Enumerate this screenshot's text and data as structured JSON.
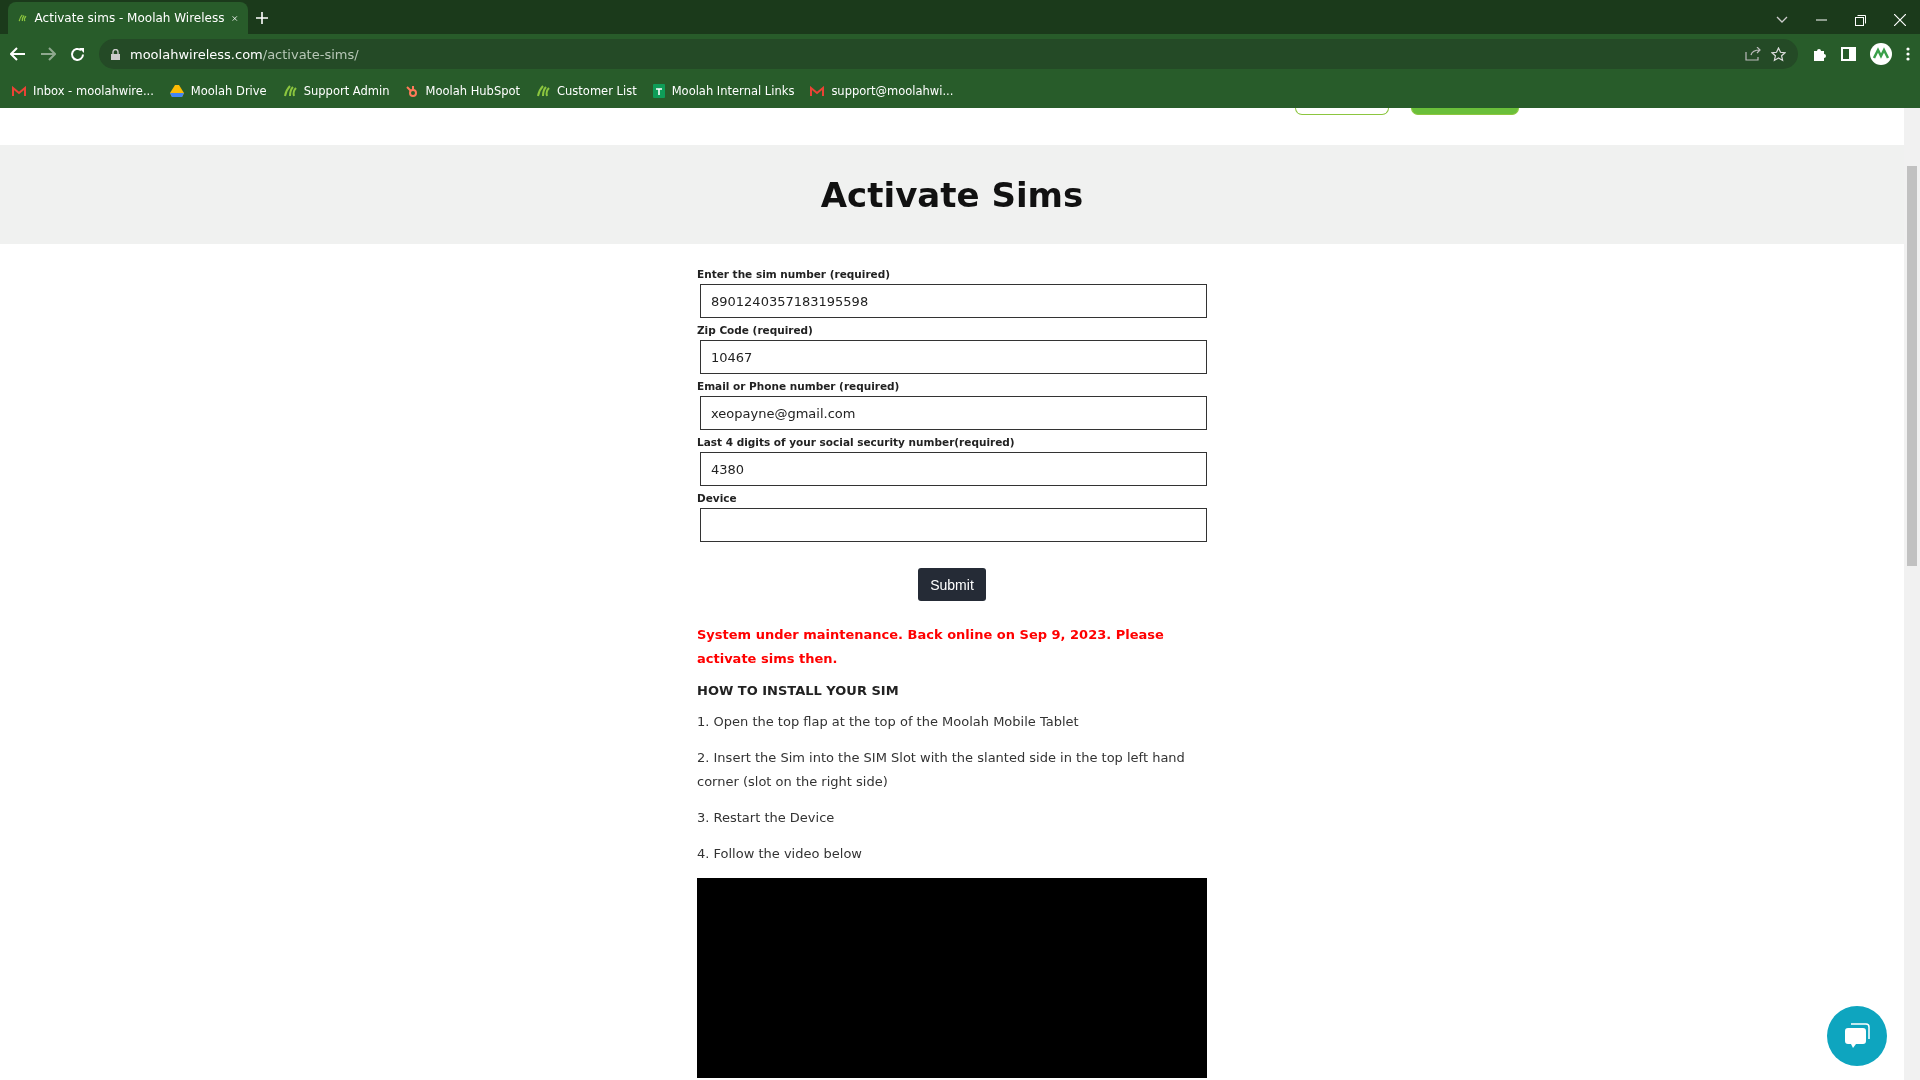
{
  "browser": {
    "tabs": [
      {
        "title": "Activate sims - Moolah Wireless",
        "selected": true
      }
    ],
    "url_host": "moolahwireless.com",
    "url_path": "/activate-sims/",
    "bookmarks": [
      {
        "label": "Inbox - moolahwire...",
        "kind": "mail"
      },
      {
        "label": "Moolah Drive",
        "kind": "drive"
      },
      {
        "label": "Support Admin",
        "kind": "leaf"
      },
      {
        "label": "Moolah HubSpot",
        "kind": "hub"
      },
      {
        "label": "Customer List",
        "kind": "leaf"
      },
      {
        "label": "Moolah Internal Links",
        "kind": "sheet"
      },
      {
        "label": "support@moolahwi...",
        "kind": "mail"
      }
    ]
  },
  "page": {
    "title": "Activate Sims",
    "fields": [
      {
        "label": "Enter the sim number (required)",
        "value": "8901240357183195598"
      },
      {
        "label": "Zip Code (required)",
        "value": "10467"
      },
      {
        "label": "Email or Phone number (required)",
        "value": "xeopayne@gmail.com"
      },
      {
        "label": "Last 4 digits of your social security number(required)",
        "value": "4380"
      },
      {
        "label": "Device"
      }
    ],
    "submit": "Submit",
    "notice": "System under maintenance. Back online on Sep 9, 2023. Please activate sims then.",
    "heading": "HOW TO INSTALL YOUR SIM",
    "steps": [
      "1. Open the top flap at the top of the Moolah Mobile Tablet",
      "2. Insert the Sim into the SIM Slot with the slanted side in the top left hand corner (slot on the right side)",
      "3. Restart the Device",
      "4. Follow the video below"
    ]
  }
}
